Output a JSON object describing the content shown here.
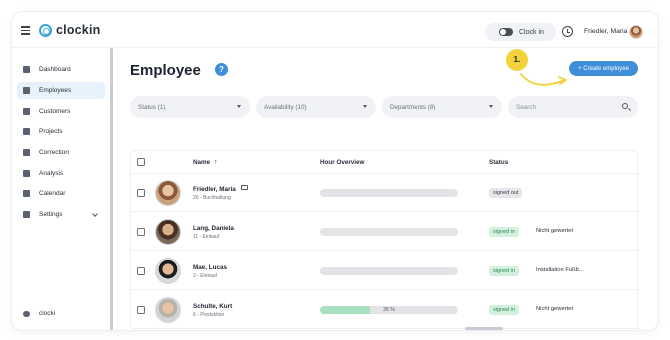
{
  "app": {
    "logo_text": "clockin"
  },
  "topbar": {
    "clockin_label": "Clock in",
    "user_name": "Friedler, Maria"
  },
  "sidebar": {
    "items": [
      {
        "label": "Dashboard",
        "icon": "dashboard-icon"
      },
      {
        "label": "Employees",
        "icon": "employees-icon",
        "active": true
      },
      {
        "label": "Customers",
        "icon": "customers-icon"
      },
      {
        "label": "Projects",
        "icon": "projects-icon"
      },
      {
        "label": "Correction",
        "icon": "correction-icon"
      },
      {
        "label": "Analysis",
        "icon": "analysis-icon"
      },
      {
        "label": "Calendar",
        "icon": "calendar-icon"
      },
      {
        "label": "Settings",
        "icon": "settings-icon"
      }
    ],
    "footer_label": "clocki"
  },
  "main": {
    "title": "Employee",
    "help_label": "?",
    "step_label": "1.",
    "create_button_label": "+ Create employee",
    "filters": [
      {
        "label": "Status (1)"
      },
      {
        "label": "Availability (10)"
      },
      {
        "label": "Departments (8)"
      }
    ],
    "search_placeholder": "Search"
  },
  "table": {
    "headers": {
      "name": "Name",
      "sort": "↑",
      "hours": "Hour Overview",
      "status": "Status"
    },
    "rows": [
      {
        "name": "Friedler, Maria",
        "dept": "20 - Buchhaltung",
        "progress": 0,
        "progress_label": "",
        "status": "signed out",
        "status_type": "out",
        "note": ""
      },
      {
        "name": "Lang, Daniela",
        "dept": "11 - Einkauf",
        "progress": 0,
        "progress_label": "",
        "status": "signed in",
        "status_type": "in",
        "note": "Nicht gewertet"
      },
      {
        "name": "Mae, Lucas",
        "dept": "3 - Einkauf",
        "progress": 0,
        "progress_label": "",
        "status": "signed in",
        "status_type": "in",
        "note": "Installation Fußb..."
      },
      {
        "name": "Schulte, Kurt",
        "dept": "6 - Produktion",
        "progress": 0.36,
        "progress_label": "36 %",
        "status": "signed in",
        "status_type": "in",
        "note": "Nicht gewertet"
      }
    ]
  },
  "colors": {
    "accent": "#3f8fd8",
    "highlight": "#f3d23a",
    "signed_in_bg": "#d3f0df",
    "signed_out_bg": "#e6e7ea",
    "progress_fill": "#a8e0c0"
  }
}
